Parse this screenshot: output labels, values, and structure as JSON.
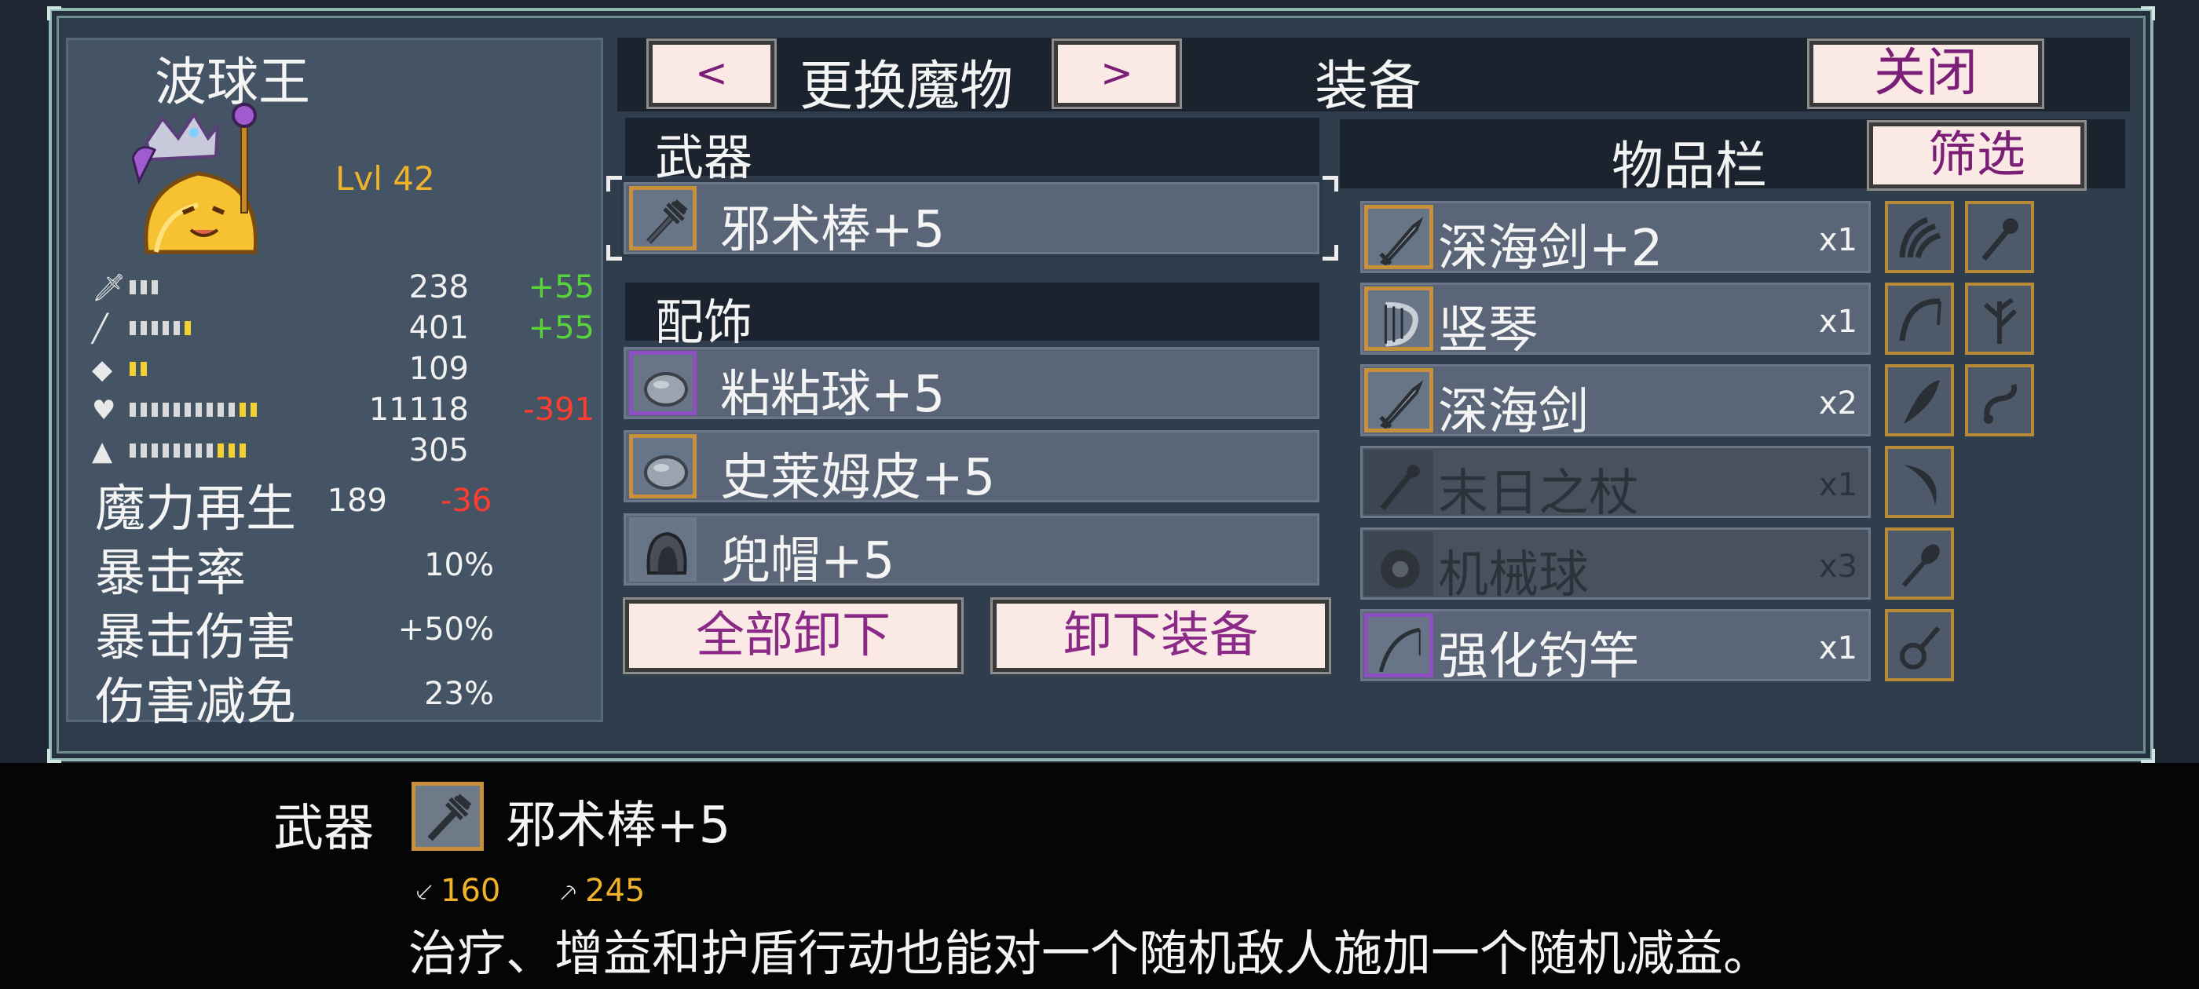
{
  "colors": {
    "window_bg": "#2f3d4c",
    "panel_bg": "#455465",
    "header_bg": "#1b232e",
    "button_bg": "#fbe9e6",
    "button_text": "#7a1f75",
    "level_gold": "#f0b22a",
    "bonus_positive": "#58d43a",
    "bonus_negative": "#ff3d2e",
    "rare_frame": "#c8903a",
    "epic_frame": "#8b4fc1"
  },
  "monster": {
    "name": "波球王",
    "level": "Lvl 42",
    "portrait_icon": "king-slime-portrait"
  },
  "stats": [
    {
      "icon": "sword-icon",
      "bar_fill": [
        3,
        0
      ],
      "value": "238",
      "bonus": "+55",
      "bonus_type": "pos"
    },
    {
      "icon": "staff-icon",
      "bar_fill": [
        5,
        1
      ],
      "value": "401",
      "bonus": "+55",
      "bonus_type": "pos"
    },
    {
      "icon": "shield-icon",
      "bar_fill": [
        0,
        2
      ],
      "value": "109",
      "bonus": "",
      "bonus_type": ""
    },
    {
      "icon": "heart-icon",
      "bar_fill": [
        10,
        2
      ],
      "value": "11118",
      "bonus": "-391",
      "bonus_type": "neg"
    },
    {
      "icon": "mana-drop-icon",
      "bar_fill": [
        8,
        3
      ],
      "value": "305",
      "bonus": "",
      "bonus_type": ""
    }
  ],
  "big_stats": [
    {
      "label": "魔力再生",
      "value": "189",
      "bonus": "-36"
    },
    {
      "label": "暴击率",
      "value": "10%",
      "bonus": ""
    },
    {
      "label": "暴击伤害",
      "value": "+50%",
      "bonus": ""
    },
    {
      "label": "伤害减免",
      "value": "23%",
      "bonus": ""
    }
  ],
  "topbar": {
    "prev_label": "<",
    "switch_label": "更换魔物",
    "next_label": ">",
    "title": "装备",
    "close_label": "关闭"
  },
  "equipped": {
    "weapon_header": "武器",
    "weapon": {
      "name": "邪术棒+5",
      "icon": "dark-wand-icon",
      "rarity": "rare"
    },
    "accessory_header": "配饰",
    "accessories": [
      {
        "name": "粘粘球+5",
        "icon": "sticky-ball-icon",
        "rarity": "epic"
      },
      {
        "name": "史莱姆皮+5",
        "icon": "slime-skin-icon",
        "rarity": "rare"
      },
      {
        "name": "兜帽+5",
        "icon": "hood-icon",
        "rarity": "none"
      }
    ],
    "unequip_all_label": "全部卸下",
    "unequip_label": "卸下装备"
  },
  "inventory": {
    "header": "物品栏",
    "filter_label": "筛选",
    "items": [
      {
        "name": "深海剑+2",
        "count": "x1",
        "icon": "deep-sea-sword-icon",
        "rarity": "rare",
        "dim": false
      },
      {
        "name": "竖琴",
        "count": "x1",
        "icon": "harp-icon",
        "rarity": "rare",
        "dim": false
      },
      {
        "name": "深海剑",
        "count": "x2",
        "icon": "deep-sea-sword-icon",
        "rarity": "rare",
        "dim": false
      },
      {
        "name": "末日之杖",
        "count": "x1",
        "icon": "doom-staff-icon",
        "rarity": "none",
        "dim": true
      },
      {
        "name": "机械球",
        "count": "x3",
        "icon": "mech-orb-icon",
        "rarity": "none",
        "dim": true
      },
      {
        "name": "强化钓竿",
        "count": "x1",
        "icon": "fishing-rod-icon",
        "rarity": "epic",
        "dim": false
      }
    ],
    "side_icons": [
      "claw-icon",
      "wand-icon",
      "bow-icon",
      "branch-icon",
      "horn-icon",
      "hook-icon",
      "crescent-icon",
      "mace-icon",
      "lute-icon"
    ]
  },
  "info": {
    "category": "武器",
    "item_name": "邪术棒+5",
    "stat1": "160",
    "stat2": "245",
    "description": "治疗、增益和护盾行动也能对一个随机敌人施加一个随机减益。"
  }
}
